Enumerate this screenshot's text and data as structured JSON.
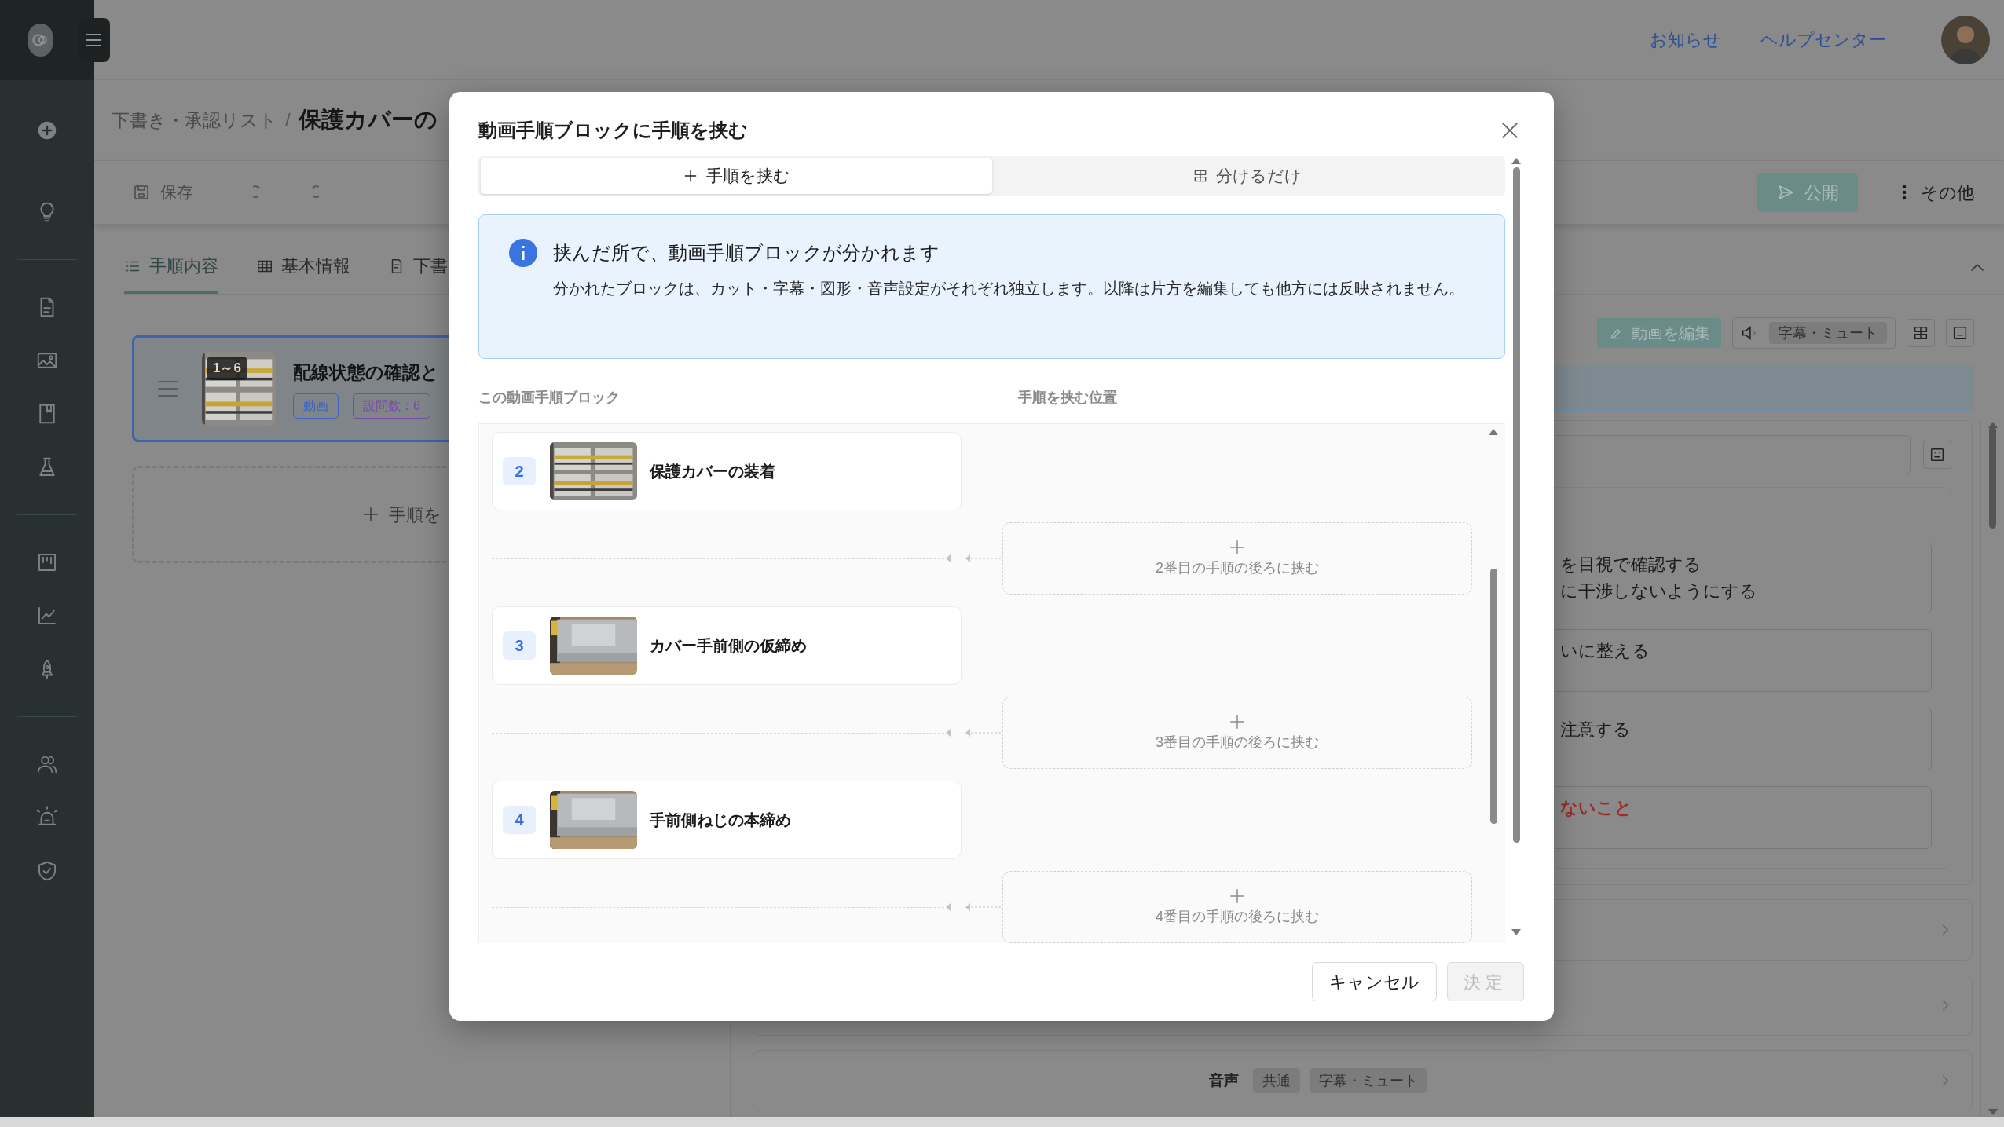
{
  "header": {
    "links": [
      "お知らせ",
      "ヘルプセンター"
    ]
  },
  "breadcrumb": {
    "parent": "下書き・承認リスト",
    "separator": "/",
    "title": "保護カバーの"
  },
  "toolbar": {
    "save": "保存",
    "publish": "公開",
    "more": "その他"
  },
  "tabs": [
    {
      "label": "手順内容",
      "selected": true
    },
    {
      "label": "基本情報",
      "selected": false
    },
    {
      "label": "下書",
      "selected": false
    }
  ],
  "step_list": {
    "card": {
      "range": "1～6",
      "title": "配線状態の確認と",
      "tags": [
        {
          "label": "動画",
          "color": "#3b63c4"
        },
        {
          "label": "設問数：6",
          "color": "#7a4aa8"
        }
      ]
    },
    "add_label": "手順を"
  },
  "editor": {
    "edit_video": "動画を編集",
    "audio_chip": "字幕・ミュート",
    "notes": [
      {
        "kind": "normal",
        "lines": [
          "を目視で確認する",
          "に干渉しないようにする"
        ]
      },
      {
        "kind": "normal",
        "lines": [
          "いに整える"
        ]
      },
      {
        "kind": "normal",
        "lines": [
          "注意する"
        ]
      },
      {
        "kind": "warning",
        "lines": [
          "ないこと"
        ]
      }
    ],
    "audio_row": {
      "label": "音声",
      "chips": [
        "共通",
        "字幕・ミュート"
      ]
    }
  },
  "dialog": {
    "title": "動画手順ブロックに手順を挟む",
    "modes": [
      {
        "kind": "insert",
        "label": "手順を挟む",
        "selected": true
      },
      {
        "kind": "split",
        "label": "分けるだけ",
        "selected": false
      }
    ],
    "info": {
      "title": "挟んだ所で、動画手順ブロックが分かれます",
      "body": "分かれたブロックは、カット・字幕・図形・音声設定がそれぞれ独立します。以降は片方を編集しても他方には反映されません。"
    },
    "column_headers": [
      "この動画手順ブロック",
      "手順を挟む位置"
    ],
    "steps": [
      {
        "number": "2",
        "title": "保護カバーの装着",
        "slot": "2番目の手順の後ろに挟む"
      },
      {
        "number": "3",
        "title": "カバー手前側の仮締め",
        "slot": "3番目の手順の後ろに挟む"
      },
      {
        "number": "4",
        "title": "手前側ねじの本締め",
        "slot": "4番目の手順の後ろに挟む"
      }
    ],
    "buttons": {
      "cancel": "キャンセル",
      "confirm": "決定",
      "confirm_disabled": true
    }
  }
}
